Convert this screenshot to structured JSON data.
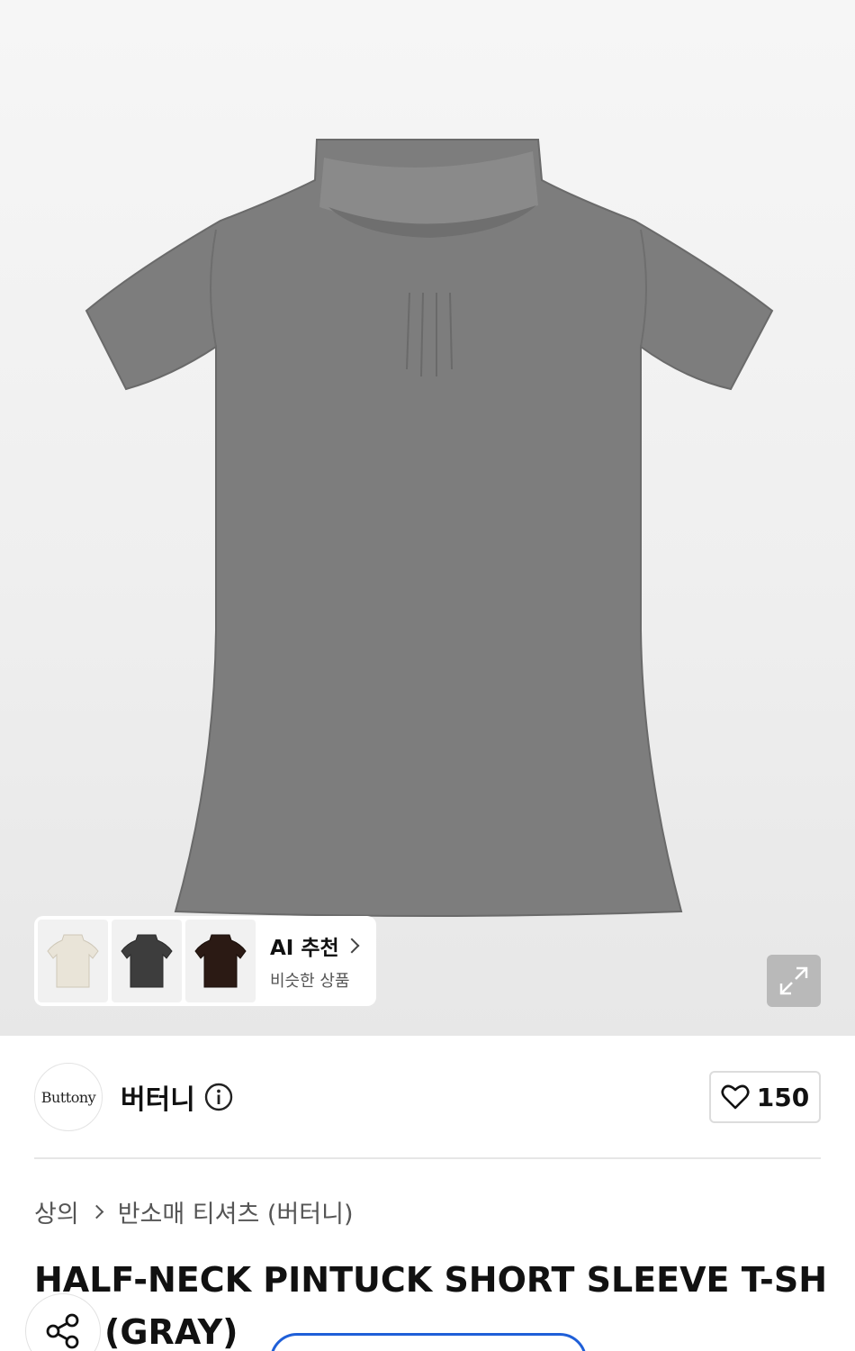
{
  "hero": {
    "image_alt": "gray half-neck pintuck short sleeve t-shirt",
    "ai_recommend": {
      "title": "AI 추천",
      "subtitle": "비슷한 상품",
      "thumbnails": [
        "ivory-shirt-thumb",
        "charcoal-shirt-thumb",
        "brown-shirt-thumb"
      ]
    },
    "expand_icon": "expand-icon"
  },
  "brand": {
    "logo_text": "Buttony",
    "name": "버터니",
    "like_count": "150"
  },
  "breadcrumb": {
    "category": "상의",
    "subcategory": "반소매 티셔츠 (버터니)"
  },
  "product": {
    "title_line1": "HALF-NECK PINTUCK SHORT SLEEVE T-SH",
    "title_line2": "(GRAY)"
  },
  "colors": {
    "accent": "#1f5fd8",
    "shirt": "#7d7d7d"
  }
}
